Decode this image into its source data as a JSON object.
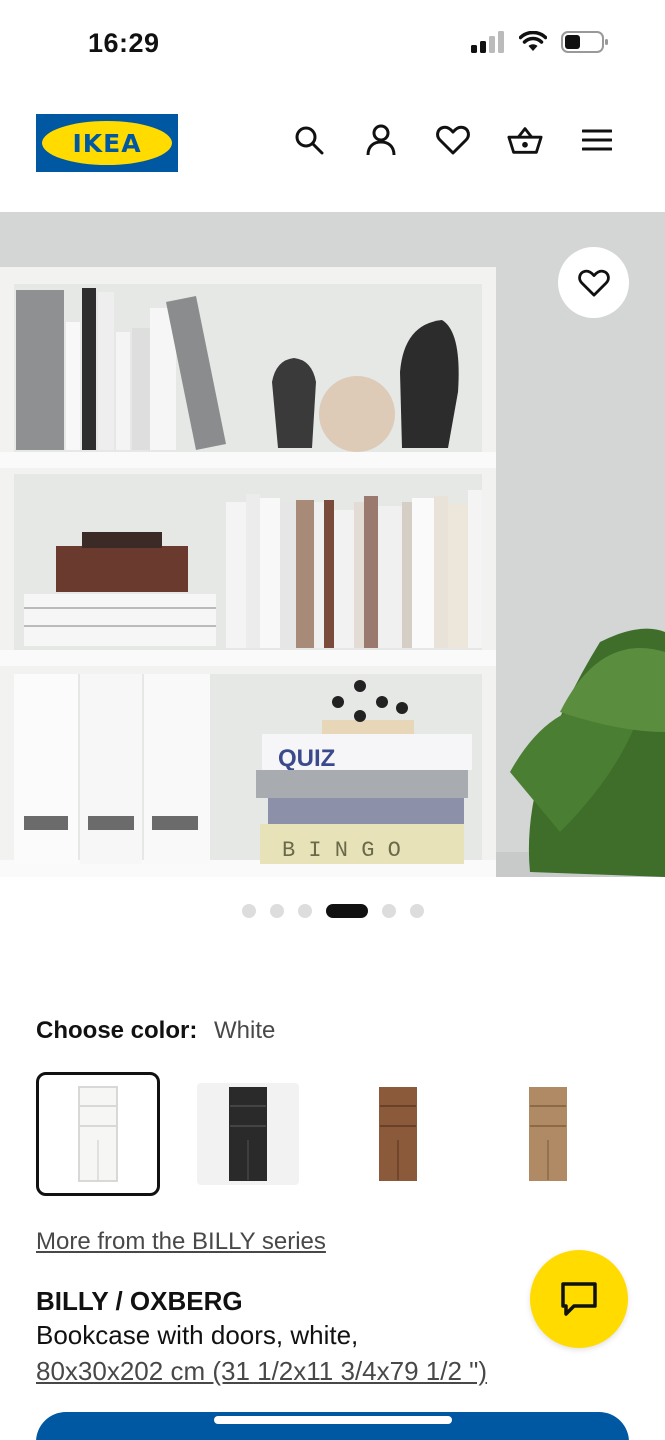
{
  "status_bar": {
    "time": "16:29"
  },
  "header": {
    "logo_text": "IKEA",
    "icons": [
      "search-icon",
      "account-icon",
      "heart-icon",
      "basket-icon",
      "menu-icon"
    ]
  },
  "hero": {
    "image_label": "",
    "slide_count": 6,
    "active_slide": 4
  },
  "color_chooser": {
    "label": "Choose color:",
    "selected_value": "White",
    "swatches": [
      {
        "color": "#f4f4f2",
        "selected": true
      },
      {
        "color": "#2a2a2a",
        "selected": false
      },
      {
        "color": "#8a5a3a",
        "selected": false
      },
      {
        "color": "#b08a64",
        "selected": false
      }
    ]
  },
  "series_link": "More from the BILLY series",
  "product": {
    "name": "BILLY / OXBERG",
    "description": "Bookcase with doors, white,",
    "size": "80x30x202 cm (31 1/2x11 3/4x79 1/2 \")"
  },
  "colors": {
    "ikea_blue": "#0058a3",
    "ikea_yellow": "#ffdb00"
  }
}
